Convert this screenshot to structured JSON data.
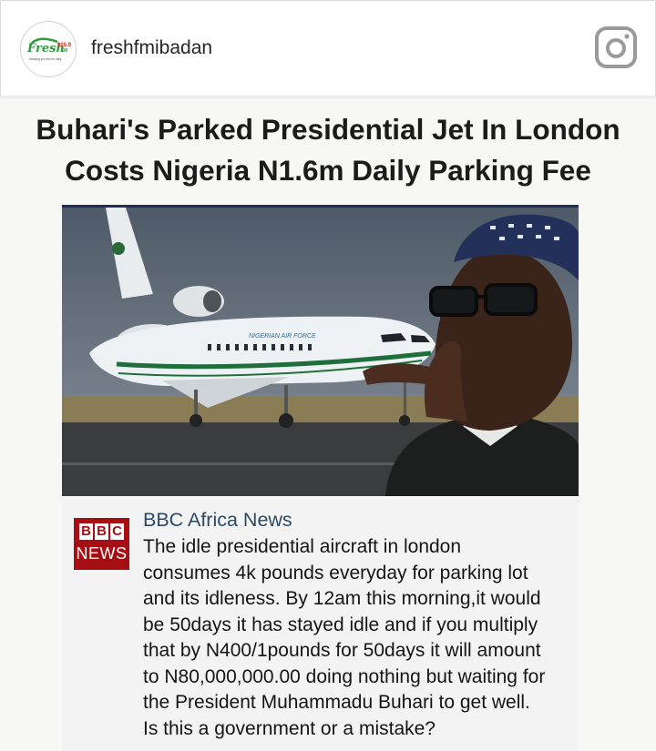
{
  "header": {
    "username": "freshfmibadan",
    "avatar_logo": {
      "brand": "Fresh",
      "frequency": "105.9",
      "band": "FM",
      "tagline": "blessing you fresh'n daily"
    },
    "icon": "instagram-icon"
  },
  "post": {
    "headline_line1": "Buhari's Parked Presidential Jet In London",
    "headline_line2": "Costs Nigeria N1.6m Daily Parking Fee",
    "jet_livery": "NIGERIAN AIR FORCE",
    "bbc": {
      "logo_letters": [
        "B",
        "B",
        "C"
      ],
      "logo_news": "NEWS",
      "title": "BBC Africa News",
      "body_lines": [
        "The idle presidential aircraft in london",
        "consumes 4k pounds everyday for parking lot",
        "and its idleness. By 12am this morning,it would",
        "be 50days it has stayed idle and if you multiply",
        "that by N400/1pounds for 50days it will amount",
        "to N80,000,000.00 doing nothing but waiting for",
        "the President Muhammadu Buhari to get well.",
        "Is this a government or a mistake?"
      ]
    }
  },
  "colors": {
    "bbc_red": "#a50f14",
    "bbc_title": "#2c4a63",
    "jet_stripe": "#1f6e3c"
  }
}
